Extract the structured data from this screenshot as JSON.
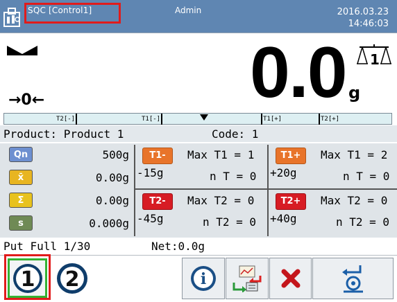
{
  "header": {
    "app_title": "SQC [Control1]",
    "user": "Admin",
    "date": "2016.03.23",
    "time": "14:46:03",
    "background_color": "#5f86b2"
  },
  "display": {
    "weight": "0.0",
    "unit": "g",
    "zero_indicator": "→0←",
    "range_number": "1"
  },
  "bargraph": {
    "markers": [
      "T2[-]",
      "T1[-]",
      "T1[+]",
      "T2[+]"
    ]
  },
  "product": {
    "label": "Product: Product 1",
    "code": "Code: 1"
  },
  "stats": [
    {
      "icon": "Qn",
      "value": "500g",
      "color": "#6d8fd0"
    },
    {
      "icon": "x̄",
      "value": "0.00g",
      "color": "#e8b521"
    },
    {
      "icon": "Σ",
      "value": "0.00g",
      "color": "#e8c21d"
    },
    {
      "icon": "s",
      "value": "0.000g",
      "color": "#6f8a55"
    }
  ],
  "thresholds": {
    "t1_minus": {
      "label": "T1-",
      "value": "-15g",
      "max": "Max T1 = 1",
      "count": "n T = 0"
    },
    "t1_plus": {
      "label": "T1+",
      "value": "+20g",
      "max": "Max T1 = 2",
      "count": "n T = 0"
    },
    "t2_minus": {
      "label": "T2-",
      "value": "-45g",
      "max": "Max T2 = 0",
      "count": "n T2 = 0"
    },
    "t2_plus": {
      "label": "T2+",
      "value": "+40g",
      "max": "Max T2 = 0",
      "count": "n T2 = 0"
    }
  },
  "status": {
    "put": "Put Full 1/30",
    "net": "Net:0.0g"
  },
  "toolbar": {
    "button_1": "1",
    "button_2": "2",
    "info_label": "i"
  }
}
